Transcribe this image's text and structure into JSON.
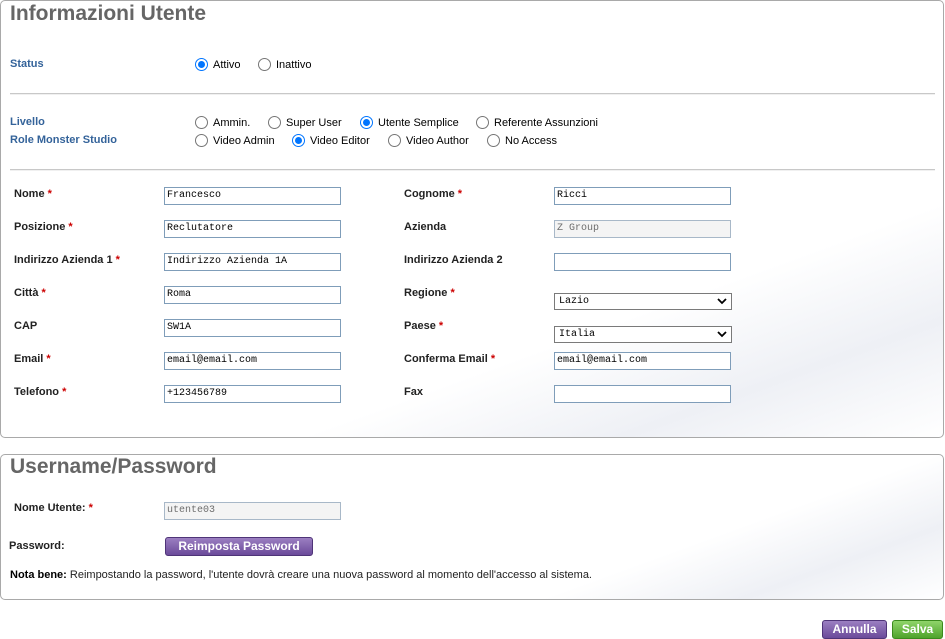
{
  "user_info": {
    "title": "Informazioni Utente",
    "status": {
      "label": "Status",
      "options": [
        {
          "label": "Attivo",
          "checked": true
        },
        {
          "label": "Inattivo",
          "checked": false
        }
      ]
    },
    "livello": {
      "label": "Livello",
      "options": [
        {
          "label": "Ammin.",
          "checked": false
        },
        {
          "label": "Super User",
          "checked": false
        },
        {
          "label": "Utente Semplice",
          "checked": true
        },
        {
          "label": "Referente Assunzioni",
          "checked": false
        }
      ]
    },
    "role": {
      "label": "Role Monster Studio",
      "options": [
        {
          "label": "Video Admin",
          "checked": false
        },
        {
          "label": "Video Editor",
          "checked": true
        },
        {
          "label": "Video Author",
          "checked": false
        },
        {
          "label": "No Access",
          "checked": false
        }
      ]
    },
    "fields": {
      "nome": {
        "label": "Nome",
        "required": "*",
        "value": "Francesco"
      },
      "cognome": {
        "label": "Cognome",
        "required": "*",
        "value": "Ricci"
      },
      "posizione": {
        "label": "Posizione",
        "required": "*",
        "value": "Reclutatore"
      },
      "azienda": {
        "label": "Azienda",
        "value": "Z Group"
      },
      "indirizzo1": {
        "label": "Indirizzo Azienda 1",
        "required": "*",
        "value": "Indirizzo Azienda 1A"
      },
      "indirizzo2": {
        "label": "Indirizzo Azienda 2",
        "value": ""
      },
      "citta": {
        "label": "Città",
        "required": "*",
        "value": "Roma"
      },
      "regione": {
        "label": "Regione",
        "required": "*",
        "value": "Lazio"
      },
      "cap": {
        "label": "CAP",
        "value": "SW1A"
      },
      "paese": {
        "label": "Paese",
        "required": "*",
        "value": "Italia"
      },
      "email": {
        "label": "Email",
        "required": "*",
        "value": "email@email.com"
      },
      "conferma_email": {
        "label": "Conferma Email",
        "required": "*",
        "value": "email@email.com"
      },
      "telefono": {
        "label": "Telefono",
        "required": "*",
        "value": "+123456789"
      },
      "fax": {
        "label": "Fax",
        "value": ""
      }
    }
  },
  "credentials": {
    "title": "Username/Password",
    "username_label": "Nome Utente:",
    "username_required": "*",
    "username_value": "utente03",
    "password_label": "Password:",
    "reset_button": "Reimposta Password",
    "note_bold": "Nota bene:",
    "note_text": " Reimpostando la password, l'utente dovrà creare una nuova password al momento dell'accesso al sistema."
  },
  "actions": {
    "cancel": "Annulla",
    "save": "Salva"
  },
  "colors": {
    "label_blue": "#34639a",
    "radio_checked": "#0075ff",
    "button_purple": "#6b4a9a",
    "button_green": "#4fa32b"
  }
}
